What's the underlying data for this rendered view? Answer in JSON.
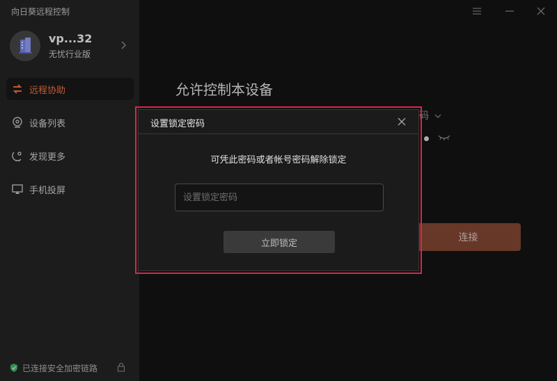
{
  "app": {
    "title": "向日葵远程控制"
  },
  "profile": {
    "name": "vp...32",
    "plan": "无忧行业版"
  },
  "sidebar": {
    "items": [
      {
        "label": "远程协助",
        "icon": "remote-assist-icon",
        "active": true
      },
      {
        "label": "设备列表",
        "icon": "device-list-icon",
        "active": false
      },
      {
        "label": "发现更多",
        "icon": "discover-icon",
        "active": false
      },
      {
        "label": "手机投屏",
        "icon": "screen-cast-icon",
        "active": false
      }
    ]
  },
  "status": {
    "text": "已连接安全加密链路"
  },
  "main": {
    "title": "允许控制本设备",
    "partial_label": "码",
    "connect_label": "连接"
  },
  "dialog": {
    "title": "设置锁定密码",
    "description": "可凭此密码或者帐号密码解除锁定",
    "input_placeholder": "设置锁定密码",
    "input_value": "",
    "button_label": "立即锁定"
  },
  "colors": {
    "accent": "#ff7a45",
    "highlight": "#d8264c",
    "connect_button": "#8a4a36",
    "status_ok": "#3fbf6a"
  }
}
